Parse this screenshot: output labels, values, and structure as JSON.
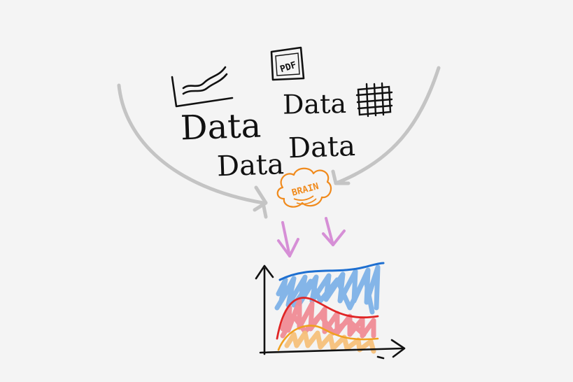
{
  "words": {
    "data_1": "Data",
    "data_2": "Data",
    "data_3": "Data",
    "data_4": "Data"
  },
  "pdf_icon_label": "PDF",
  "brain_label": "BRAIN",
  "colors": {
    "background": "#f4f4f4",
    "ink": "#111111",
    "gray_arrow": "#c4c4c4",
    "brain": "#f08a1c",
    "purple_arrow": "#d68fd6",
    "blue": "#1e6fd0",
    "blue_fill": "#7fb2e8",
    "red": "#e02525",
    "pink_fill": "#f08c96",
    "orange": "#f0a020",
    "orange_fill": "#f6c07a"
  },
  "icons": {
    "chart": "line-chart-icon",
    "pdf": "pdf-document-icon",
    "spreadsheet": "table-grid-icon"
  }
}
